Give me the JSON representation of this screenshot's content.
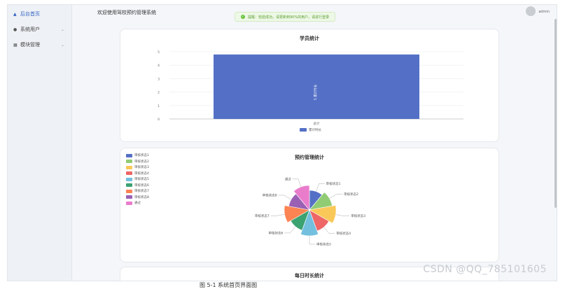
{
  "sidebar": {
    "items": [
      {
        "label": "后台首页",
        "icon": "home-icon",
        "active": true,
        "expandable": false
      },
      {
        "label": "系统用户",
        "icon": "user-icon",
        "active": false,
        "expandable": true
      },
      {
        "label": "模块管理",
        "icon": "grid-icon",
        "active": false,
        "expandable": true
      }
    ]
  },
  "header": {
    "welcome": "欢迎使用驾校预约管理系统",
    "toast": "提醒：检验成功，请更新到90%的用户，请进行登录",
    "username": "admin"
  },
  "cards": {
    "students": {
      "title": "学员统计"
    },
    "reservations": {
      "title": "预约管理统计"
    },
    "daily": {
      "title": "每日时长统计"
    }
  },
  "chart_data": [
    {
      "type": "bar",
      "title": "学员统计",
      "categories": [
        "总计"
      ],
      "series": [
        {
          "name": "累计时长",
          "values": [
            4.8
          ]
        }
      ],
      "data_labels": [
        "5 累计时长"
      ],
      "ylim": [
        0,
        5
      ],
      "yticks": [
        0,
        1,
        2,
        3,
        4,
        5
      ],
      "legend": "bottom",
      "grid": true,
      "color": "#5470c6"
    },
    {
      "type": "pie",
      "title": "预约管理统计",
      "legend": "top-left",
      "slices": [
        {
          "label": "审核状态1",
          "value": 1,
          "color": "#5470c6"
        },
        {
          "label": "审核状态2",
          "value": 1,
          "color": "#91cc75"
        },
        {
          "label": "审核状态3",
          "value": 1,
          "color": "#fac858"
        },
        {
          "label": "审核状态4",
          "value": 1,
          "color": "#ee6666"
        },
        {
          "label": "审核状态5",
          "value": 1,
          "color": "#73c0de"
        },
        {
          "label": "审核状态6",
          "value": 1,
          "color": "#3ba272"
        },
        {
          "label": "审核状态7",
          "value": 1,
          "color": "#fc8452"
        },
        {
          "label": "审核状态8",
          "value": 1,
          "color": "#9a60b4"
        },
        {
          "label": "通过",
          "value": 1,
          "color": "#ea7ccc"
        }
      ]
    }
  ],
  "watermark": "CSDN @QQ_785101605",
  "caption": "图 5-1 系统首页界面图"
}
